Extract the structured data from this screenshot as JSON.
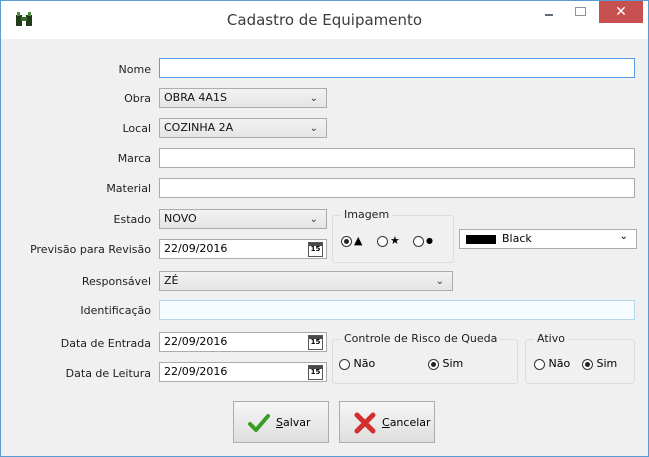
{
  "window": {
    "title": "Cadastro de Equipamento",
    "close_glyph": "✕"
  },
  "form": {
    "nome_label": "Nome",
    "nome_value": "",
    "obra_label": "Obra",
    "obra_value": "OBRA 4A1S",
    "local_label": "Local",
    "local_value": "COZINHA 2A",
    "marca_label": "Marca",
    "marca_value": "",
    "material_label": "Material",
    "material_value": "",
    "estado_label": "Estado",
    "estado_value": "NOVO",
    "revisao_label": "Previsão para Revisão",
    "revisao_value": "22/09/2016",
    "responsavel_label": "Responsável",
    "responsavel_value": "ZÉ",
    "identificacao_label": "Identificação",
    "identificacao_value": "",
    "entrada_label": "Data de Entrada",
    "entrada_value": "22/09/2016",
    "leitura_label": "Data de Leitura",
    "leitura_value": "22/09/2016",
    "calendar_glyph": "15"
  },
  "imagem": {
    "title": "Imagem",
    "options": [
      {
        "symbol": "▲",
        "selected": true
      },
      {
        "symbol": "★",
        "selected": false
      },
      {
        "symbol": "●",
        "selected": false
      }
    ],
    "color_label": "Black",
    "color_value": "#000000"
  },
  "risco": {
    "title": "Controle de Risco de Queda",
    "nao_label": "Não",
    "sim_label": "Sim",
    "selected": "Sim"
  },
  "ativo": {
    "title": "Ativo",
    "nao_label": "Não",
    "sim_label": "Sim",
    "selected": "Sim"
  },
  "buttons": {
    "salvar_prefix": "S",
    "salvar_rest": "alvar",
    "cancelar_prefix": "C",
    "cancelar_rest": "ancelar"
  },
  "icons": {
    "app": "binoculars-icon",
    "save": "checkmark-icon",
    "cancel": "red-x-icon"
  },
  "colors": {
    "title_close_bg": "#c75050",
    "focus_border": "#569de5",
    "save_icon": "#3a9d23",
    "cancel_icon": "#d32f2f"
  }
}
